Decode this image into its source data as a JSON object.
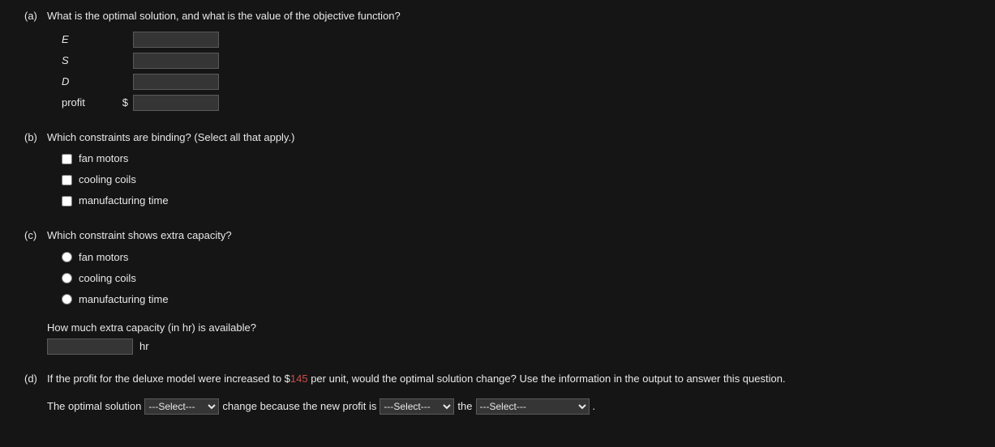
{
  "parts": {
    "a": {
      "label": "(a)",
      "question": "What is the optimal solution, and what is the value of the objective function?",
      "rows": [
        {
          "label": "E",
          "italic": true,
          "prefix": "",
          "value": ""
        },
        {
          "label": "S",
          "italic": true,
          "prefix": "",
          "value": ""
        },
        {
          "label": "D",
          "italic": true,
          "prefix": "",
          "value": ""
        },
        {
          "label": "profit",
          "italic": false,
          "prefix": "$",
          "value": ""
        }
      ]
    },
    "b": {
      "label": "(b)",
      "question": "Which constraints are binding? (Select all that apply.)",
      "options": [
        "fan motors",
        "cooling coils",
        "manufacturing time"
      ]
    },
    "c": {
      "label": "(c)",
      "question": "Which constraint shows extra capacity?",
      "options": [
        "fan motors",
        "cooling coils",
        "manufacturing time"
      ],
      "sub_question": "How much extra capacity (in hr) is available?",
      "extra_value": "",
      "unit": "hr"
    },
    "d": {
      "label": "(d)",
      "question_before_price": "If the profit for the deluxe model were increased to $",
      "price": "145",
      "question_after_price": " per unit, would the optimal solution change? Use the information in the output to answer this question.",
      "sentence": {
        "t1": "The optimal solution",
        "sel1_placeholder": "---Select---",
        "t2": "change because the new profit is",
        "sel2_placeholder": "---Select---",
        "t3": "the",
        "sel3_placeholder": "---Select---",
        "t4": "."
      }
    }
  }
}
